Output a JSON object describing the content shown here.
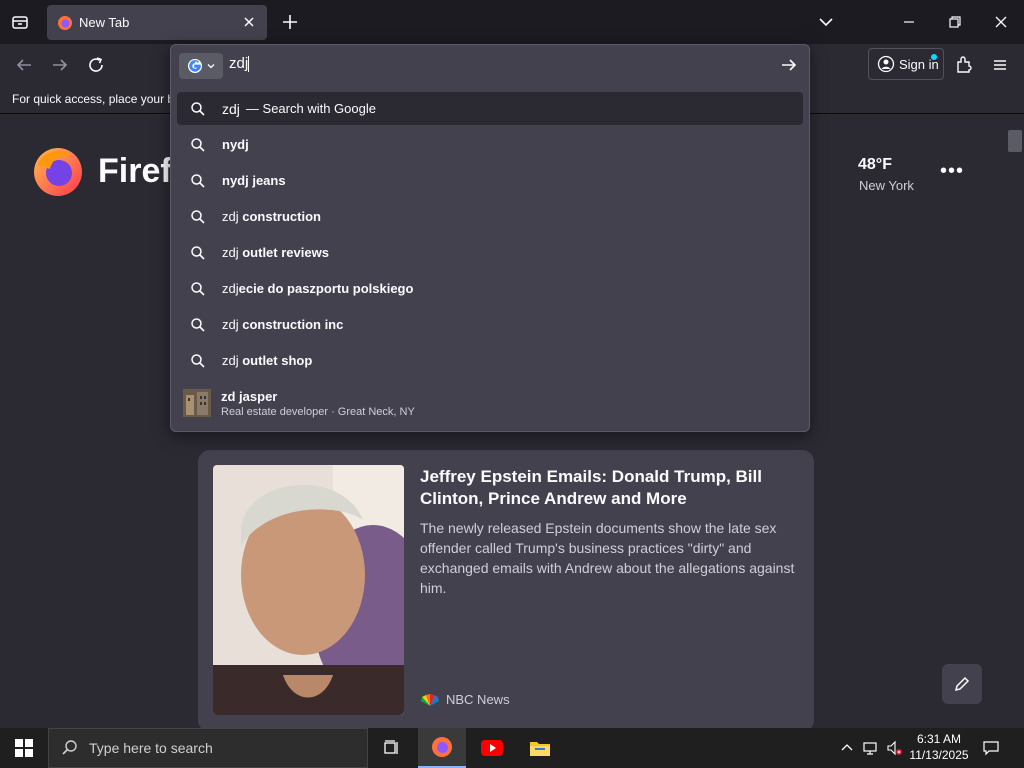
{
  "tab": {
    "title": "New Tab"
  },
  "bookmarks": {
    "hint": "For quick access, place your bo"
  },
  "account": {
    "sign_in_label": "Sign in"
  },
  "urlbar": {
    "value": "zdj"
  },
  "suggestions": [
    {
      "typed": "zdj",
      "completion": "",
      "hint": "— Search with Google"
    },
    {
      "typed": "",
      "completion": "nydj"
    },
    {
      "typed": "",
      "completion": "nydj jeans"
    },
    {
      "typed": "zdj ",
      "completion": "construction"
    },
    {
      "typed": "zdj ",
      "completion": "outlet reviews"
    },
    {
      "typed": "zdj",
      "completion": "ecie do paszportu polskiego"
    },
    {
      "typed": "zdj ",
      "completion": "construction inc"
    },
    {
      "typed": "zdj ",
      "completion": "outlet shop"
    },
    {
      "title": "zd jasper",
      "subtitle": "Real estate developer · Great Neck, NY"
    }
  ],
  "newtab": {
    "brand": "Firefox",
    "weather": {
      "temp": "48°F",
      "location": "New York"
    },
    "story": {
      "headline": "Jeffrey Epstein Emails: Donald Trump, Bill Clinton, Prince Andrew and More",
      "excerpt": "The newly released Epstein documents show the late sex offender called Trump's business practices \"dirty\" and exchanged emails with Andrew about the allegations against him.",
      "source": "NBC News"
    }
  },
  "taskbar": {
    "search_placeholder": "Type here to search",
    "time": "6:31 AM",
    "date": "11/13/2025"
  },
  "colors": {
    "accent": "#00ddff",
    "panel": "#42414d",
    "toolbar": "#2b2a33",
    "frame": "#1c1b22"
  }
}
